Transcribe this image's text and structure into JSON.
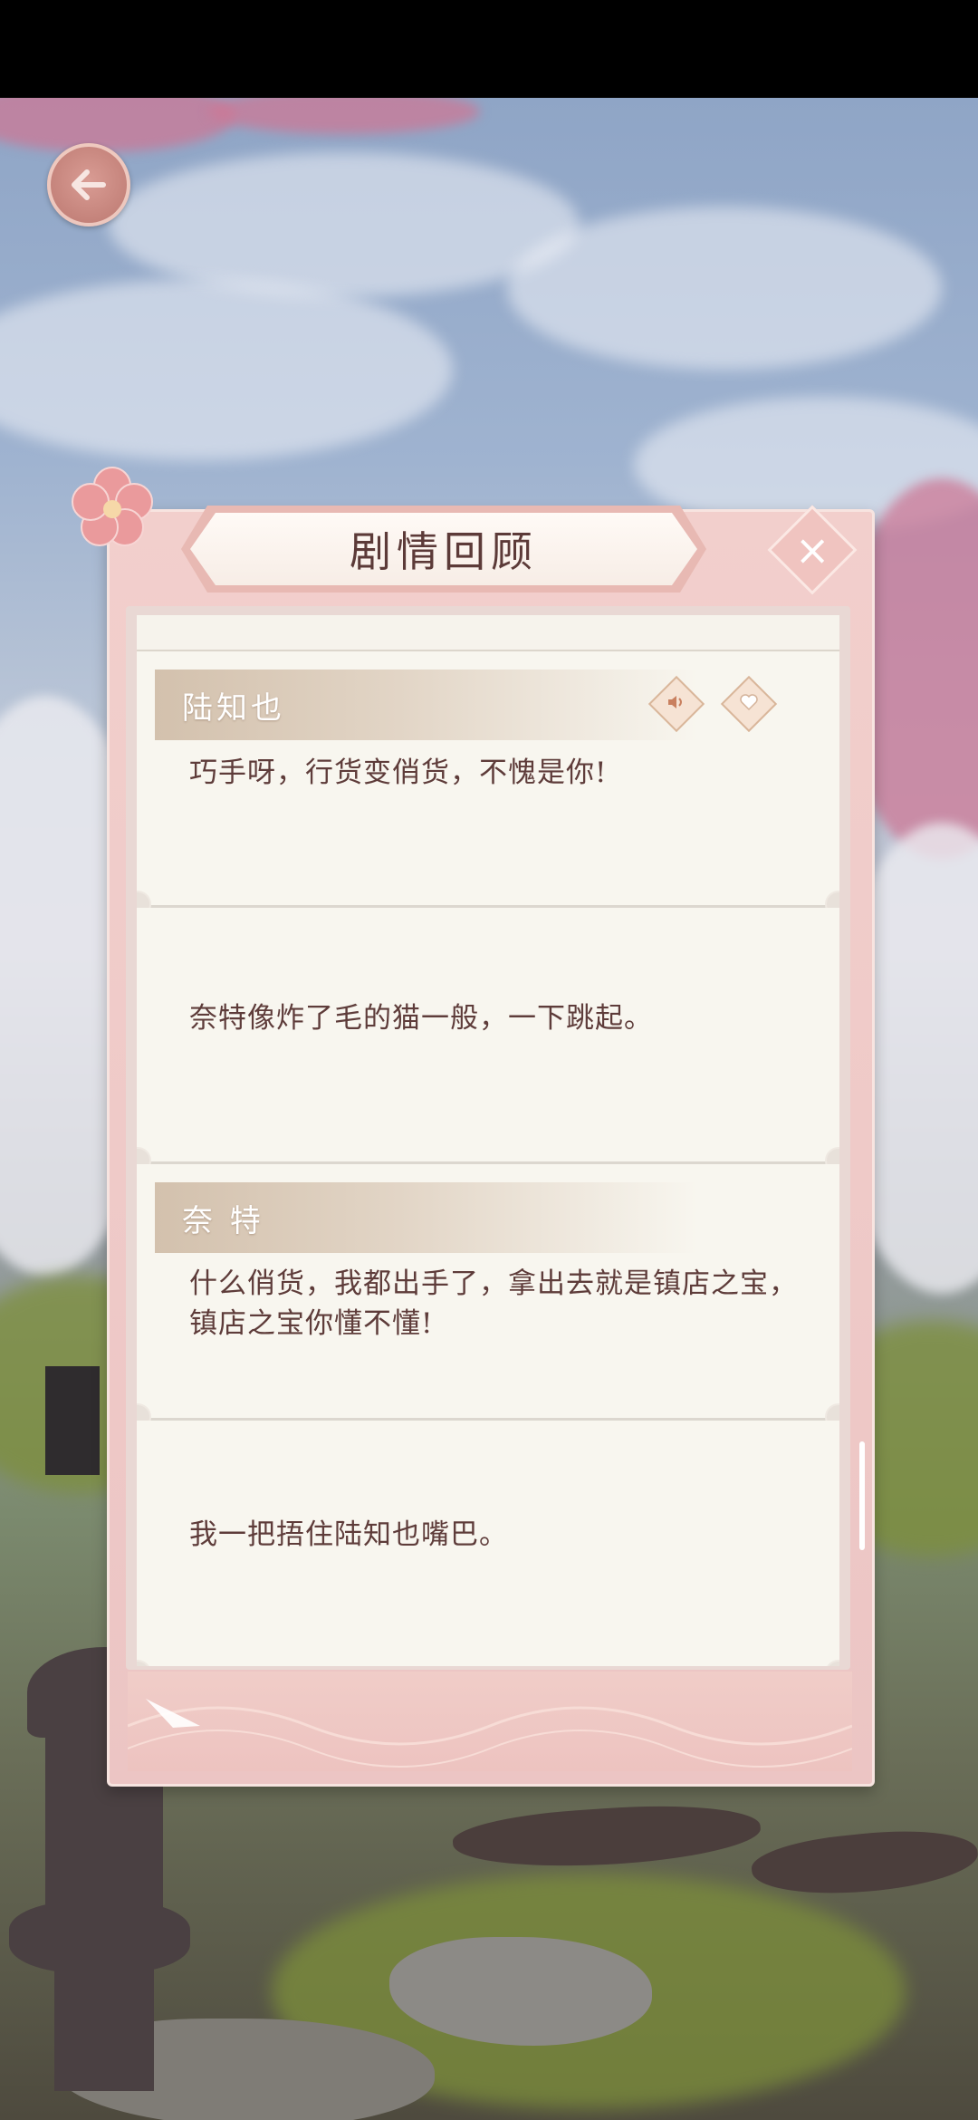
{
  "panel": {
    "title": "剧情回顾"
  },
  "entries": [
    {
      "speaker": "陆知也",
      "text": "巧手呀，行货变俏货，不愧是你!",
      "has_actions": true
    },
    {
      "speaker": "",
      "text": "奈特像炸了毛的猫一般，一下跳起。",
      "has_actions": false
    },
    {
      "speaker": "奈 特",
      "text": "什么俏货，我都出手了，拿出去就是镇店之宝，镇店之宝你懂不懂!",
      "has_actions": false
    },
    {
      "speaker": "",
      "text": "我一把捂住陆知也嘴巴。",
      "has_actions": false
    }
  ],
  "icons": {
    "back": "back-arrow-icon",
    "close": "close-icon",
    "voice": "speaker-icon",
    "favorite": "heart-icon"
  },
  "colors": {
    "panel_pink": "#ecc5c4",
    "text_brown": "#5e3c3a",
    "name_bar": "#d3c1ad"
  }
}
